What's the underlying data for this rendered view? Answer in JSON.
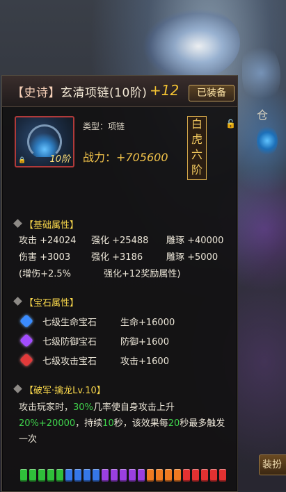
{
  "header": {
    "rarity": "【史诗】",
    "item_name": "玄清项链(10阶)",
    "enhance": "+12",
    "equipped_label": "已装备"
  },
  "item": {
    "icon": "necklace-icon",
    "tier_label": "10阶",
    "type_label": "类型：项链",
    "power_label": "战力：",
    "power_value": "+705600",
    "seal": [
      "白",
      "虎",
      "六",
      "阶"
    ]
  },
  "base": {
    "title": "【基础属性】",
    "rows": [
      [
        "攻击 +24024",
        "强化 +25488",
        "雕琢 +40000"
      ],
      [
        "伤害 +3003",
        "强化 +3186",
        "雕琢 +5000"
      ],
      [
        "(增伤+2.5%",
        "强化+12奖励属性)"
      ]
    ]
  },
  "gems": {
    "title": "【宝石属性】",
    "items": [
      {
        "name": "七级生命宝石",
        "value": "生命+16000",
        "color": "#3b8cff"
      },
      {
        "name": "七级防御宝石",
        "value": "防御+1600",
        "color": "#a24cff"
      },
      {
        "name": "七级攻击宝石",
        "value": "攻击+1600",
        "color": "#e23a3a"
      }
    ]
  },
  "skill": {
    "title": "【破军·擒龙Lv.10】",
    "line1_a": "攻击玩家时，",
    "line1_b": "30%",
    "line1_c": "几率使自身攻击上升",
    "line2_a": "20%+20000",
    "line2_b": "，持续",
    "line2_c": "10",
    "line2_d": "秒，该效果每",
    "line2_e": "20",
    "line2_f": "秒最多触发",
    "line3": "一次"
  },
  "quality_bar": [
    "#2fbf3a",
    "#2fbf3a",
    "#2fbf3a",
    "#2fbf3a",
    "#2fbf3a",
    "#3577e8",
    "#3577e8",
    "#3577e8",
    "#3577e8",
    "#9a3fe0",
    "#9a3fe0",
    "#9a3fe0",
    "#9a3fe0",
    "#9a3fe0",
    "#f07a21",
    "#f07a21",
    "#f07a21",
    "#f07a21",
    "#e33131",
    "#e33131",
    "#e33131",
    "#e33131",
    "#e33131"
  ],
  "side": {
    "char": "仓",
    "bottom_button": "装扮"
  }
}
